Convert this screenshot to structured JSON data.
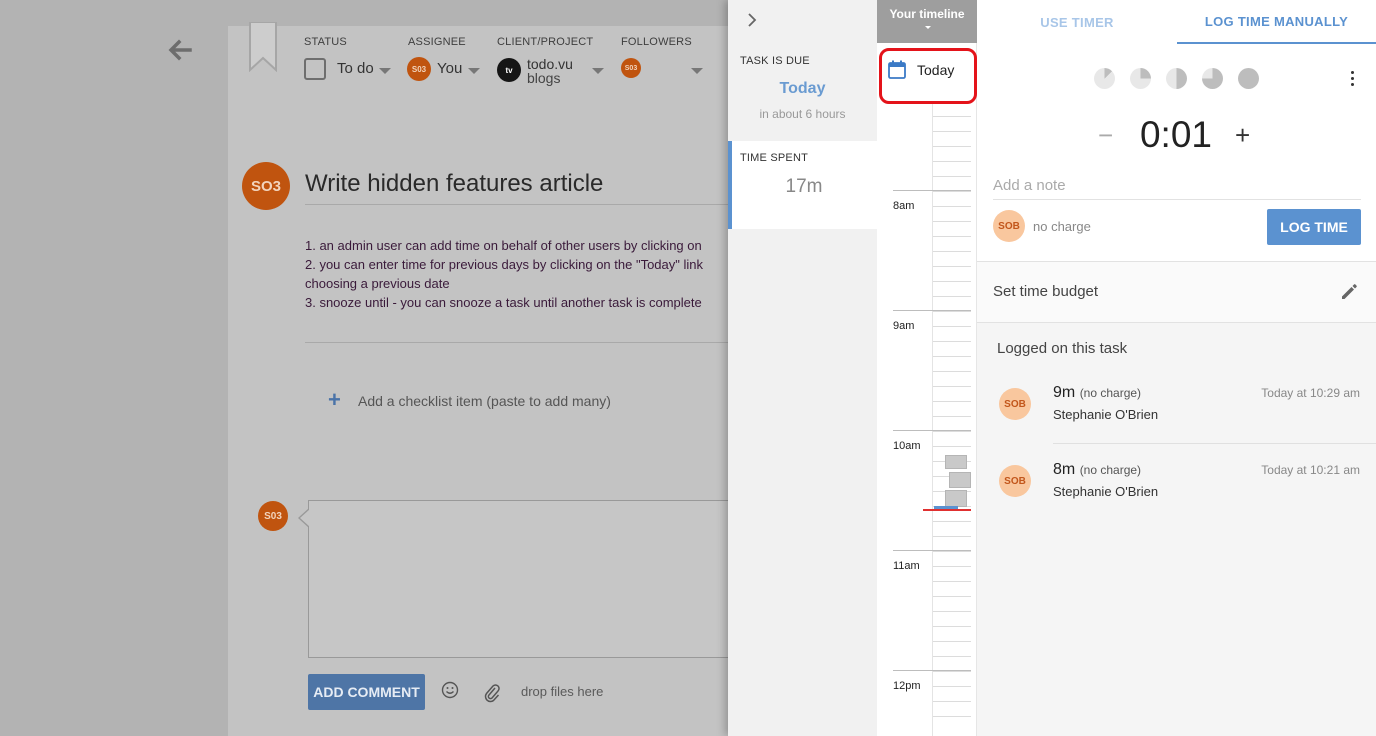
{
  "task": {
    "status_label": "STATUS",
    "status_value": "To do",
    "assignee_label": "ASSIGNEE",
    "assignee_avatar": "S03",
    "assignee_value": "You",
    "client_label": "CLIENT/PROJECT",
    "client_logo": "tv",
    "client_name": "todo.vu",
    "project_name": "blogs",
    "followers_label": "FOLLOWERS",
    "follower_avatar": "S03",
    "owner_avatar": "SO3",
    "title": "Write hidden features article",
    "description": [
      "1. an admin user can add time on behalf of other users by clicking on",
      "2. you can enter time for previous days by clicking on the \"Today\" link",
      "choosing a previous date",
      "3. snooze until - you can snooze a task until another task is complete"
    ],
    "checklist_placeholder": "Add a checklist item (paste to add many)",
    "commenter_avatar": "S03",
    "add_comment_label": "ADD COMMENT",
    "drop_files_label": "drop files here"
  },
  "info": {
    "due_label": "TASK IS DUE",
    "due_value": "Today",
    "due_sub": "in about 6 hours",
    "spent_label": "TIME SPENT",
    "spent_value": "17m"
  },
  "timeline": {
    "header": "Your timeline",
    "date": "Today",
    "hours": [
      "8am",
      "9am",
      "10am",
      "11am",
      "12pm"
    ]
  },
  "log": {
    "tabs": [
      "USE TIMER",
      "LOG TIME MANUALLY"
    ],
    "active_tab": "LOG TIME MANUALLY",
    "quick_fractions": [
      0.125,
      0.25,
      0.5,
      0.75,
      1.0
    ],
    "minus": "−",
    "duration": "0:01",
    "plus": "+",
    "note_placeholder": "Add a note",
    "user_avatar": "SOB",
    "charge_label": "no charge",
    "log_button": "LOG TIME",
    "budget_label": "Set time budget",
    "logged_heading": "Logged on this task",
    "entries": [
      {
        "avatar": "SOB",
        "duration": "9m",
        "charge": "(no charge)",
        "user": "Stephanie O'Brien",
        "time": "Today at 10:29 am"
      },
      {
        "avatar": "SOB",
        "duration": "8m",
        "charge": "(no charge)",
        "user": "Stephanie O'Brien",
        "time": "Today at 10:21 am"
      }
    ]
  },
  "colors": {
    "accent": "#5b92d0",
    "highlight_border": "#e4131a",
    "avatar_orange": "#c0540f",
    "avatar_peach": "#f9c79e"
  }
}
